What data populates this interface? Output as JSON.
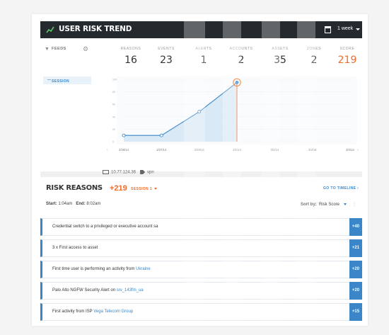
{
  "header": {
    "title": "USER RISK TREND",
    "range": "1 week"
  },
  "feeds": {
    "label": "FEEDS",
    "session_label": "SESSION"
  },
  "stats": [
    {
      "key": "REASONS",
      "value": "16"
    },
    {
      "key": "EVENTS",
      "value": "23"
    },
    {
      "key": "ALERTS",
      "value": "1"
    },
    {
      "key": "ACCOUNTS",
      "value": "2"
    },
    {
      "key": "ASSETS",
      "value": "35"
    },
    {
      "key": "ZONES",
      "value": "2"
    },
    {
      "key": "SCORE",
      "value": "219"
    }
  ],
  "chart_data": {
    "type": "line",
    "x": [
      "2/26/14",
      "2/27/14",
      "2/28/14",
      "3/1/14",
      "3/2/14",
      "3/3/14",
      "3/4/14"
    ],
    "y_ticks": [
      "0",
      "20",
      "40",
      "60",
      "80",
      "100"
    ],
    "ylim": [
      0,
      100
    ],
    "series": [
      {
        "values": [
          10,
          10,
          48,
          95
        ]
      }
    ],
    "highlight_index": 3,
    "accent": "#ef6c2a",
    "line_color": "#3a86c8"
  },
  "chart_footer": {
    "ip": "10.77.124.36",
    "tag": "vpn"
  },
  "risk_reasons": {
    "title": "RISK REASONS",
    "score": "+219",
    "session_label": "SESSION 1",
    "timeline_link": "GO TO TIMELINE",
    "start_label": "Start:",
    "start_value": "1:04am",
    "end_label": "End:",
    "end_value": "8:02am",
    "sort_label": "Sort by:",
    "sort_value": "Risk Score",
    "items": [
      {
        "text": "Credential switch to a privileged or executive account sa",
        "link": "",
        "points": "+40"
      },
      {
        "text": "3 x First access to asset",
        "link": "",
        "points": "+21"
      },
      {
        "text": "First time user is performing an activity from ",
        "link": "Ukraine",
        "points": "+20"
      },
      {
        "text": "Palo Alto NGFW Security Alert on ",
        "link": "srv_143fm_ua",
        "points": "+20"
      },
      {
        "text": "First activity from ISP ",
        "link": "Vega Telecom Group",
        "points": "+15"
      }
    ]
  }
}
